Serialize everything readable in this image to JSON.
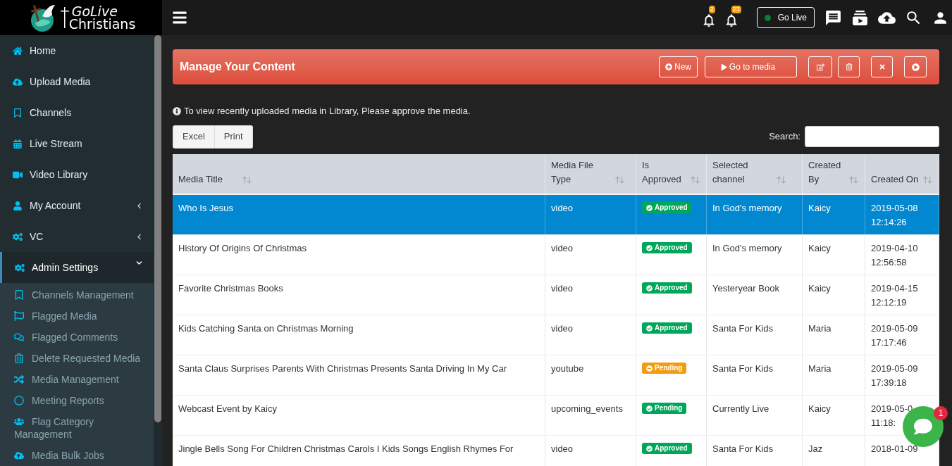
{
  "logo": {
    "line1": "GoLive",
    "line2": "Christians"
  },
  "topbar": {
    "notifications": [
      {
        "count": "2"
      },
      {
        "count": "23"
      }
    ],
    "go_live": {
      "label": "Go Live",
      "on": true
    }
  },
  "sidebar": {
    "items": [
      {
        "label": "Home",
        "selected": false
      },
      {
        "label": "Upload Media",
        "selected": false
      },
      {
        "label": "Channels",
        "selected": false
      },
      {
        "label": "Live Stream",
        "selected": false
      },
      {
        "label": "Video Library",
        "selected": false
      },
      {
        "label": "My Account",
        "selected": false,
        "expanded": false
      },
      {
        "label": "VC",
        "selected": false,
        "expanded": false
      },
      {
        "label": "Admin Settings",
        "selected": true,
        "expanded": true,
        "children": [
          {
            "label": "Channels Management"
          },
          {
            "label": "Flagged Media"
          },
          {
            "label": "Flagged Comments"
          },
          {
            "label": "Delete Requested Media"
          },
          {
            "label": "Media Management"
          },
          {
            "label": "Meeting Reports"
          },
          {
            "label": "Flag Category Management"
          },
          {
            "label": "Media Bulk Jobs"
          }
        ]
      }
    ]
  },
  "panel": {
    "title": "Manage Your Content",
    "buttons": [
      {
        "label": "New"
      },
      {
        "label": "Go to media"
      }
    ]
  },
  "info": "To view recently uploaded media in Library, Please approve the media.",
  "export_buttons": [
    "Excel",
    "Print"
  ],
  "search": {
    "label": "Search:"
  },
  "table": {
    "columns": [
      "Media Title",
      "Media File Type",
      "Is Approved",
      "Selected channel",
      "Created By",
      "Created On"
    ],
    "rows": [
      {
        "title": "Who Is Jesus",
        "type": "video",
        "status": {
          "label": "Approved",
          "color": "#00a65a",
          "kind": "check"
        },
        "channel": "In God's memory",
        "by": "Kaicy",
        "date": "2019-05-08",
        "time": "12:14:26",
        "selected": true
      },
      {
        "title": "History Of Origins Of Christmas",
        "type": "video",
        "status": {
          "label": "Approved",
          "color": "#00a65a",
          "kind": "check"
        },
        "channel": "In God's memory",
        "by": "Kaicy",
        "date": "2019-04-10",
        "time": "12:56:58",
        "selected": false
      },
      {
        "title": "Favorite Christmas Books",
        "type": "video",
        "status": {
          "label": "Approved",
          "color": "#00a65a",
          "kind": "check"
        },
        "channel": "Yesteryear Book",
        "by": "Kaicy",
        "date": "2019-04-15",
        "time": "12:12:19",
        "selected": false
      },
      {
        "title": "Kids Catching Santa on Christmas Morning",
        "type": "video",
        "status": {
          "label": "Approved",
          "color": "#00a65a",
          "kind": "check"
        },
        "channel": "Santa For Kids",
        "by": "Maria",
        "date": "2019-05-09",
        "time": "17:17:46",
        "selected": false
      },
      {
        "title": "Santa Claus Surprises Parents With Christmas Presents Santa Driving In My Car",
        "type": "youtube",
        "status": {
          "label": "Pending",
          "color": "#f39c12",
          "kind": "minus"
        },
        "channel": "Santa For Kids",
        "by": "Maria",
        "date": "2019-05-09",
        "time": "17:39:18",
        "selected": false
      },
      {
        "title": "Webcast Event by Kaicy",
        "type": "upcoming_events",
        "status": {
          "label": "Pending",
          "color": "#00a65a",
          "kind": "check"
        },
        "channel": "Currently Live",
        "by": "Kaicy",
        "date": "2019-05-0",
        "time": "11:18:",
        "selected": false
      },
      {
        "title": "Jingle Bells Song For Children Christmas Carols I Kids Songs English Rhymes For",
        "type": "video",
        "status": {
          "label": "Approved",
          "color": "#00a65a",
          "kind": "check"
        },
        "channel": "Santa For Kids",
        "by": "Jaz",
        "date": "2018-01-09",
        "selected": false
      }
    ]
  },
  "chat": {
    "count": "1"
  }
}
